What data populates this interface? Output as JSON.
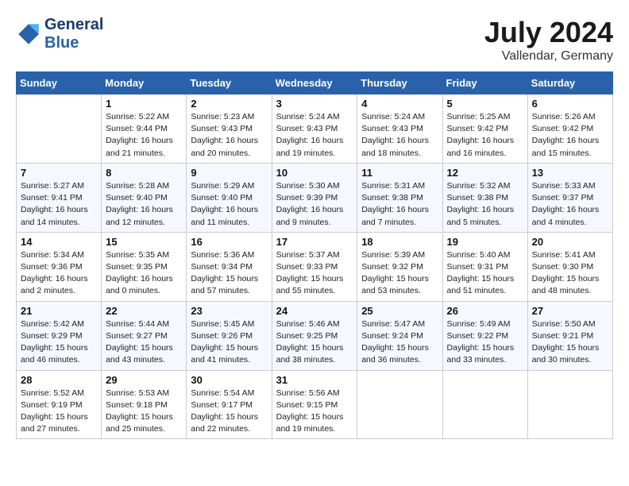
{
  "header": {
    "logo_line1": "General",
    "logo_line2": "Blue",
    "month_title": "July 2024",
    "subtitle": "Vallendar, Germany"
  },
  "columns": [
    "Sunday",
    "Monday",
    "Tuesday",
    "Wednesday",
    "Thursday",
    "Friday",
    "Saturday"
  ],
  "weeks": [
    [
      {
        "day": "",
        "info": ""
      },
      {
        "day": "1",
        "info": "Sunrise: 5:22 AM\nSunset: 9:44 PM\nDaylight: 16 hours\nand 21 minutes."
      },
      {
        "day": "2",
        "info": "Sunrise: 5:23 AM\nSunset: 9:43 PM\nDaylight: 16 hours\nand 20 minutes."
      },
      {
        "day": "3",
        "info": "Sunrise: 5:24 AM\nSunset: 9:43 PM\nDaylight: 16 hours\nand 19 minutes."
      },
      {
        "day": "4",
        "info": "Sunrise: 5:24 AM\nSunset: 9:43 PM\nDaylight: 16 hours\nand 18 minutes."
      },
      {
        "day": "5",
        "info": "Sunrise: 5:25 AM\nSunset: 9:42 PM\nDaylight: 16 hours\nand 16 minutes."
      },
      {
        "day": "6",
        "info": "Sunrise: 5:26 AM\nSunset: 9:42 PM\nDaylight: 16 hours\nand 15 minutes."
      }
    ],
    [
      {
        "day": "7",
        "info": "Sunrise: 5:27 AM\nSunset: 9:41 PM\nDaylight: 16 hours\nand 14 minutes."
      },
      {
        "day": "8",
        "info": "Sunrise: 5:28 AM\nSunset: 9:40 PM\nDaylight: 16 hours\nand 12 minutes."
      },
      {
        "day": "9",
        "info": "Sunrise: 5:29 AM\nSunset: 9:40 PM\nDaylight: 16 hours\nand 11 minutes."
      },
      {
        "day": "10",
        "info": "Sunrise: 5:30 AM\nSunset: 9:39 PM\nDaylight: 16 hours\nand 9 minutes."
      },
      {
        "day": "11",
        "info": "Sunrise: 5:31 AM\nSunset: 9:38 PM\nDaylight: 16 hours\nand 7 minutes."
      },
      {
        "day": "12",
        "info": "Sunrise: 5:32 AM\nSunset: 9:38 PM\nDaylight: 16 hours\nand 5 minutes."
      },
      {
        "day": "13",
        "info": "Sunrise: 5:33 AM\nSunset: 9:37 PM\nDaylight: 16 hours\nand 4 minutes."
      }
    ],
    [
      {
        "day": "14",
        "info": "Sunrise: 5:34 AM\nSunset: 9:36 PM\nDaylight: 16 hours\nand 2 minutes."
      },
      {
        "day": "15",
        "info": "Sunrise: 5:35 AM\nSunset: 9:35 PM\nDaylight: 16 hours\nand 0 minutes."
      },
      {
        "day": "16",
        "info": "Sunrise: 5:36 AM\nSunset: 9:34 PM\nDaylight: 15 hours\nand 57 minutes."
      },
      {
        "day": "17",
        "info": "Sunrise: 5:37 AM\nSunset: 9:33 PM\nDaylight: 15 hours\nand 55 minutes."
      },
      {
        "day": "18",
        "info": "Sunrise: 5:39 AM\nSunset: 9:32 PM\nDaylight: 15 hours\nand 53 minutes."
      },
      {
        "day": "19",
        "info": "Sunrise: 5:40 AM\nSunset: 9:31 PM\nDaylight: 15 hours\nand 51 minutes."
      },
      {
        "day": "20",
        "info": "Sunrise: 5:41 AM\nSunset: 9:30 PM\nDaylight: 15 hours\nand 48 minutes."
      }
    ],
    [
      {
        "day": "21",
        "info": "Sunrise: 5:42 AM\nSunset: 9:29 PM\nDaylight: 15 hours\nand 46 minutes."
      },
      {
        "day": "22",
        "info": "Sunrise: 5:44 AM\nSunset: 9:27 PM\nDaylight: 15 hours\nand 43 minutes."
      },
      {
        "day": "23",
        "info": "Sunrise: 5:45 AM\nSunset: 9:26 PM\nDaylight: 15 hours\nand 41 minutes."
      },
      {
        "day": "24",
        "info": "Sunrise: 5:46 AM\nSunset: 9:25 PM\nDaylight: 15 hours\nand 38 minutes."
      },
      {
        "day": "25",
        "info": "Sunrise: 5:47 AM\nSunset: 9:24 PM\nDaylight: 15 hours\nand 36 minutes."
      },
      {
        "day": "26",
        "info": "Sunrise: 5:49 AM\nSunset: 9:22 PM\nDaylight: 15 hours\nand 33 minutes."
      },
      {
        "day": "27",
        "info": "Sunrise: 5:50 AM\nSunset: 9:21 PM\nDaylight: 15 hours\nand 30 minutes."
      }
    ],
    [
      {
        "day": "28",
        "info": "Sunrise: 5:52 AM\nSunset: 9:19 PM\nDaylight: 15 hours\nand 27 minutes."
      },
      {
        "day": "29",
        "info": "Sunrise: 5:53 AM\nSunset: 9:18 PM\nDaylight: 15 hours\nand 25 minutes."
      },
      {
        "day": "30",
        "info": "Sunrise: 5:54 AM\nSunset: 9:17 PM\nDaylight: 15 hours\nand 22 minutes."
      },
      {
        "day": "31",
        "info": "Sunrise: 5:56 AM\nSunset: 9:15 PM\nDaylight: 15 hours\nand 19 minutes."
      },
      {
        "day": "",
        "info": ""
      },
      {
        "day": "",
        "info": ""
      },
      {
        "day": "",
        "info": ""
      }
    ]
  ]
}
